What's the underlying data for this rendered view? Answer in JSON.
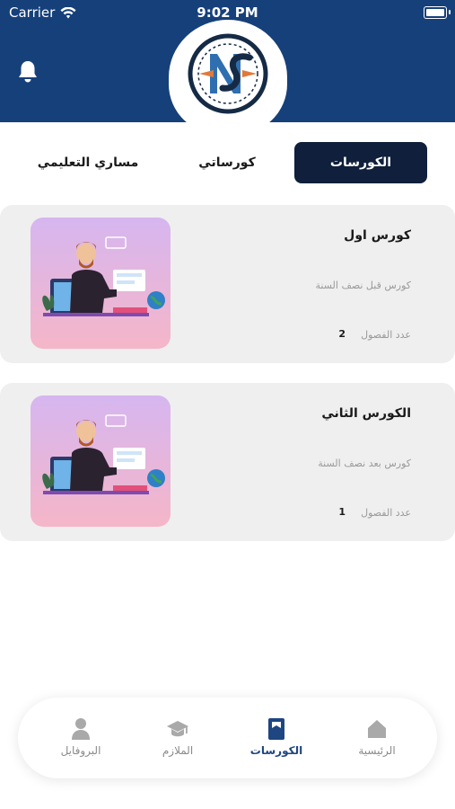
{
  "status_bar": {
    "carrier": "Carrier",
    "time": "9:02 PM"
  },
  "colors": {
    "header": "#16407a",
    "active_tab": "#0f1f3c",
    "card_bg": "#efefef",
    "nav_active": "#1e4680"
  },
  "tabs": [
    {
      "label": "الكورسات",
      "active": true
    },
    {
      "label": "كورساتي",
      "active": false
    },
    {
      "label": "مساري التعليمي",
      "active": false
    }
  ],
  "courses": [
    {
      "title": "كورس اول",
      "subtitle": "كورس قبل نصف السنة",
      "chapters_label": "عدد الفصول",
      "chapters": "2"
    },
    {
      "title": "الكورس الثاني",
      "subtitle": "كورس بعد نصف السنة",
      "chapters_label": "عدد الفصول",
      "chapters": "1"
    }
  ],
  "bottom_nav": [
    {
      "label": "الرئيسية",
      "icon": "home-icon",
      "active": false
    },
    {
      "label": "الكورسات",
      "icon": "book-icon",
      "active": true
    },
    {
      "label": "الملازم",
      "icon": "graduation-cap-icon",
      "active": false
    },
    {
      "label": "البروفايل",
      "icon": "person-icon",
      "active": false
    }
  ]
}
